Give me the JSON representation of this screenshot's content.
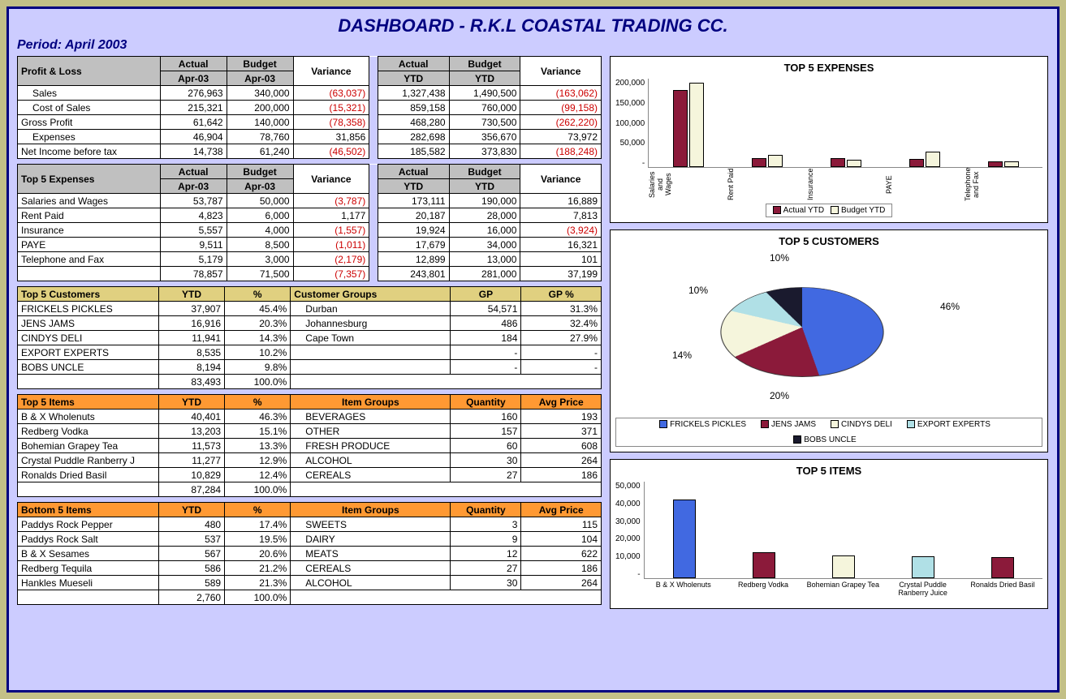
{
  "title": "DASHBOARD - R.K.L COASTAL TRADING CC.",
  "period_label": "Period:  April 2003",
  "pl": {
    "headers": [
      "Profit & Loss",
      "Actual Apr-03",
      "Budget Apr-03",
      "Variance",
      "Actual YTD",
      "Budget YTD",
      "Variance"
    ],
    "rows": [
      {
        "label": "Sales",
        "indent": true,
        "a": "276,963",
        "b": "340,000",
        "v": "(63,037)",
        "vn": true,
        "ay": "1,327,438",
        "by": "1,490,500",
        "vy": "(163,062)",
        "vyn": true
      },
      {
        "label": "Cost of Sales",
        "indent": true,
        "a": "215,321",
        "b": "200,000",
        "v": "(15,321)",
        "vn": true,
        "ay": "859,158",
        "by": "760,000",
        "vy": "(99,158)",
        "vyn": true
      },
      {
        "label": "Gross Profit",
        "a": "61,642",
        "b": "140,000",
        "v": "(78,358)",
        "vn": true,
        "ay": "468,280",
        "by": "730,500",
        "vy": "(262,220)",
        "vyn": true
      },
      {
        "label": "Expenses",
        "indent": true,
        "a": "46,904",
        "b": "78,760",
        "v": "31,856",
        "ay": "282,698",
        "by": "356,670",
        "vy": "73,972"
      },
      {
        "label": "Net Income before tax",
        "a": "14,738",
        "b": "61,240",
        "v": "(46,502)",
        "vn": true,
        "ay": "185,582",
        "by": "373,830",
        "vy": "(188,248)",
        "vyn": true
      }
    ]
  },
  "exp": {
    "headers": [
      "Top 5 Expenses",
      "Actual Apr-03",
      "Budget Apr-03",
      "Variance",
      "Actual YTD",
      "Budget YTD",
      "Variance"
    ],
    "rows": [
      {
        "label": "Salaries and Wages",
        "a": "53,787",
        "b": "50,000",
        "v": "(3,787)",
        "vn": true,
        "ay": "173,111",
        "by": "190,000",
        "vy": "16,889"
      },
      {
        "label": "Rent Paid",
        "a": "4,823",
        "b": "6,000",
        "v": "1,177",
        "ay": "20,187",
        "by": "28,000",
        "vy": "7,813"
      },
      {
        "label": "Insurance",
        "a": "5,557",
        "b": "4,000",
        "v": "(1,557)",
        "vn": true,
        "ay": "19,924",
        "by": "16,000",
        "vy": "(3,924)",
        "vyn": true
      },
      {
        "label": "PAYE",
        "a": "9,511",
        "b": "8,500",
        "v": "(1,011)",
        "vn": true,
        "ay": "17,679",
        "by": "34,000",
        "vy": "16,321"
      },
      {
        "label": "Telephone and Fax",
        "a": "5,179",
        "b": "3,000",
        "v": "(2,179)",
        "vn": true,
        "ay": "12,899",
        "by": "13,000",
        "vy": "101"
      }
    ],
    "total": {
      "a": "78,857",
      "b": "71,500",
      "v": "(7,357)",
      "vn": true,
      "ay": "243,801",
      "by": "281,000",
      "vy": "37,199"
    }
  },
  "cust": {
    "h1": "Top 5 Customers",
    "h2": "YTD",
    "h3": "%",
    "h4": "Customer Groups",
    "h5": "GP",
    "h6": "GP %",
    "rows": [
      {
        "n": "FRICKELS PICKLES",
        "y": "37,907",
        "p": "45.4%",
        "g": "Durban",
        "gp": "54,571",
        "gpp": "31.3%"
      },
      {
        "n": "JENS JAMS",
        "y": "16,916",
        "p": "20.3%",
        "g": "Johannesburg",
        "gp": "486",
        "gpp": "32.4%"
      },
      {
        "n": "CINDYS DELI",
        "y": "11,941",
        "p": "14.3%",
        "g": "Cape Town",
        "gp": "184",
        "gpp": "27.9%"
      },
      {
        "n": "EXPORT EXPERTS",
        "y": "8,535",
        "p": "10.2%",
        "g": "",
        "gp": "-",
        "gpp": "-"
      },
      {
        "n": "BOBS UNCLE",
        "y": "8,194",
        "p": "9.8%",
        "g": "",
        "gp": "-",
        "gpp": "-"
      }
    ],
    "total": {
      "y": "83,493",
      "p": "100.0%"
    }
  },
  "items": {
    "h1": "Top 5 Items",
    "h2": "YTD",
    "h3": "%",
    "h4": "Item Groups",
    "h5": "Quantity",
    "h6": "Avg Price",
    "rows": [
      {
        "n": "B & X Wholenuts",
        "y": "40,401",
        "p": "46.3%",
        "g": "BEVERAGES",
        "q": "160",
        "ap": "193"
      },
      {
        "n": "Redberg Vodka",
        "y": "13,203",
        "p": "15.1%",
        "g": "OTHER",
        "q": "157",
        "ap": "371"
      },
      {
        "n": "Bohemian Grapey Tea",
        "y": "11,573",
        "p": "13.3%",
        "g": "FRESH PRODUCE",
        "q": "60",
        "ap": "608"
      },
      {
        "n": "Crystal Puddle Ranberry J",
        "y": "11,277",
        "p": "12.9%",
        "g": "ALCOHOL",
        "q": "30",
        "ap": "264"
      },
      {
        "n": "Ronalds Dried Basil",
        "y": "10,829",
        "p": "12.4%",
        "g": "CEREALS",
        "q": "27",
        "ap": "186"
      }
    ],
    "total": {
      "y": "87,284",
      "p": "100.0%"
    }
  },
  "bottom": {
    "h1": "Bottom 5 Items",
    "h2": "YTD",
    "h3": "%",
    "h4": "Item Groups",
    "h5": "Quantity",
    "h6": "Avg Price",
    "rows": [
      {
        "n": "Paddys Rock Pepper",
        "y": "480",
        "p": "17.4%",
        "g": "SWEETS",
        "q": "3",
        "ap": "115"
      },
      {
        "n": "Paddys Rock Salt",
        "y": "537",
        "p": "19.5%",
        "g": "DAIRY",
        "q": "9",
        "ap": "104"
      },
      {
        "n": "B & X Sesames",
        "y": "567",
        "p": "20.6%",
        "g": "MEATS",
        "q": "12",
        "ap": "622"
      },
      {
        "n": "Redberg Tequila",
        "y": "586",
        "p": "21.2%",
        "g": "CEREALS",
        "q": "27",
        "ap": "186"
      },
      {
        "n": "Hankles Mueseli",
        "y": "589",
        "p": "21.3%",
        "g": "ALCOHOL",
        "q": "30",
        "ap": "264"
      }
    ],
    "total": {
      "y": "2,760",
      "p": "100.0%"
    }
  },
  "chart_data": [
    {
      "type": "bar",
      "title": "TOP 5 EXPENSES",
      "categories": [
        "Salaries and Wages",
        "Rent Paid",
        "Insurance",
        "PAYE",
        "Telephone and Fax"
      ],
      "series": [
        {
          "name": "Actual YTD",
          "values": [
            173111,
            20187,
            19924,
            17679,
            12899
          ]
        },
        {
          "name": "Budget YTD",
          "values": [
            190000,
            28000,
            16000,
            34000,
            13000
          ]
        }
      ],
      "ylim": [
        0,
        200000
      ],
      "yticks": [
        "200,000",
        "150,000",
        "100,000",
        "50,000",
        "-"
      ]
    },
    {
      "type": "pie",
      "title": "TOP 5 CUSTOMERS",
      "categories": [
        "FRICKELS PICKLES",
        "JENS JAMS",
        "CINDYS DELI",
        "EXPORT EXPERTS",
        "BOBS UNCLE"
      ],
      "values": [
        46,
        20,
        14,
        10,
        10
      ],
      "labels": [
        "46%",
        "20%",
        "14%",
        "10%",
        "10%"
      ]
    },
    {
      "type": "bar",
      "title": "TOP 5 ITEMS",
      "categories": [
        "B & X Wholenuts",
        "Redberg Vodka",
        "Bohemian Grapey Tea",
        "Crystal Puddle Ranberry Juice",
        "Ronalds Dried Basil"
      ],
      "series": [
        {
          "name": "YTD",
          "values": [
            40401,
            13203,
            11573,
            11277,
            10829
          ]
        }
      ],
      "ylim": [
        0,
        50000
      ],
      "yticks": [
        "50,000",
        "40,000",
        "30,000",
        "20,000",
        "10,000",
        "-"
      ],
      "colors": [
        "#4169e1",
        "#8b1a3a",
        "#f5f5dc",
        "#b0e0e6",
        "#8b1a3a"
      ]
    }
  ]
}
